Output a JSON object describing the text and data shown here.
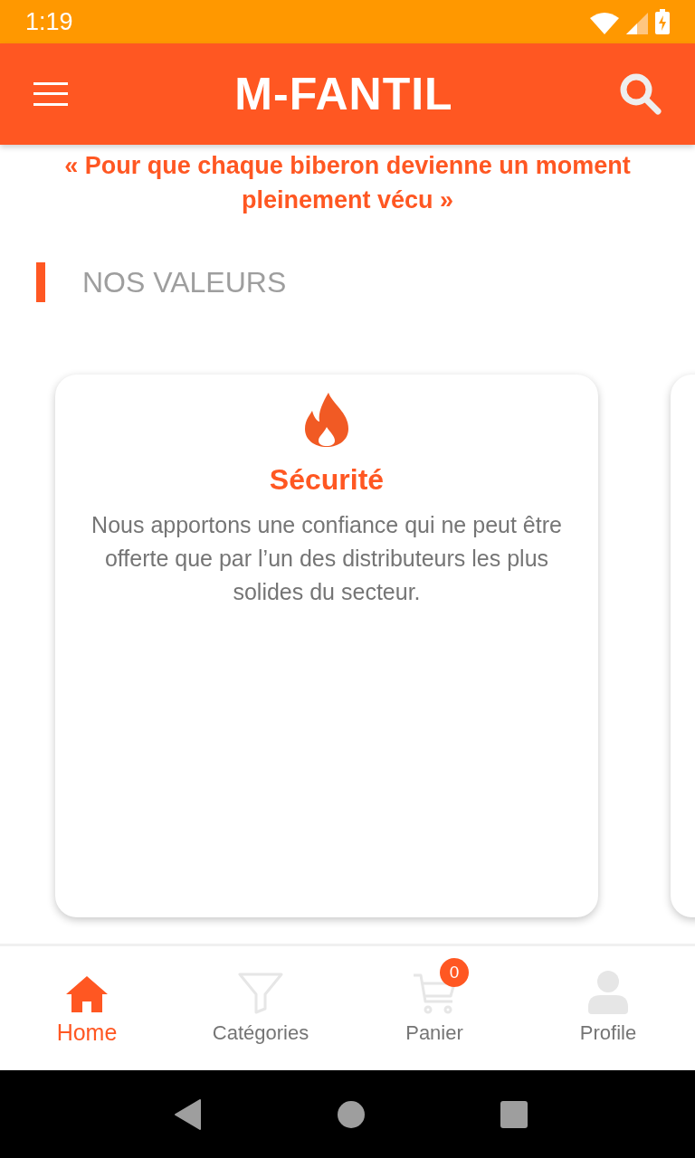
{
  "status_bar": {
    "time": "1:19"
  },
  "app_bar": {
    "title": "M-FANTIL"
  },
  "quote": "« Pour que chaque biberon devienne un moment pleinement vécu »",
  "section": {
    "title": "NOS VALEURS"
  },
  "value_cards": [
    {
      "title": "Sécurité",
      "description": "Nous apportons une confiance qui ne peut être offerte que par l’un des distributeurs les plus solides du secteur."
    }
  ],
  "bottom_nav": [
    {
      "kind": "home",
      "label": "Home",
      "selected": true
    },
    {
      "kind": "categories",
      "label": "Catégories",
      "selected": false
    },
    {
      "kind": "cart",
      "label": "Panier",
      "selected": false,
      "badge": "0"
    },
    {
      "kind": "profile",
      "label": "Profile",
      "selected": false
    }
  ]
}
